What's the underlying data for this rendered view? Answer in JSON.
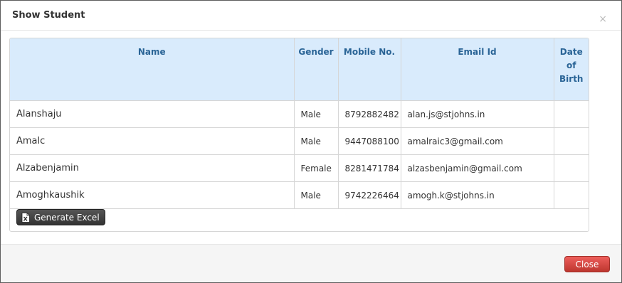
{
  "dialog": {
    "title": "Show Student",
    "close_symbol": "×"
  },
  "table": {
    "headers": {
      "name": "Name",
      "gender": "Gender",
      "mobile": "Mobile No.",
      "email": "Email Id",
      "dob_line1": "Date",
      "dob_line2": "of",
      "dob_line3": "Birth"
    },
    "rows": [
      {
        "name": "Alanshaju",
        "gender": "Male",
        "mobile": "8792882482",
        "email": "alan.js@stjohns.in",
        "dob": ""
      },
      {
        "name": "Amalc",
        "gender": "Male",
        "mobile": "9447088100",
        "email": "amalraic3@gmail.com",
        "dob": ""
      },
      {
        "name": "Alzabenjamin",
        "gender": "Female",
        "mobile": "8281471784",
        "email": "alzasbenjamin@gmail.com",
        "dob": ""
      },
      {
        "name": "Amoghkaushik",
        "gender": "Male",
        "mobile": "9742226464",
        "email": "amogh.k@stjohns.in",
        "dob": ""
      }
    ]
  },
  "actions": {
    "generate_excel_label": "Generate Excel",
    "generate_excel_icon": "excel-file-icon",
    "close_label": "Close"
  },
  "colors": {
    "header_bg": "#d9ebfc",
    "header_text": "#2a6496",
    "close_button": "#da4f49",
    "excel_button": "#444444"
  }
}
